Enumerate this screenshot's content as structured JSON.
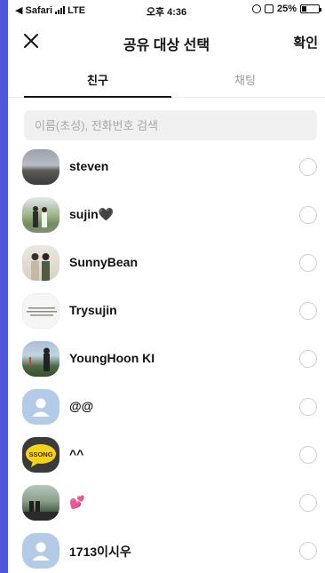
{
  "status_bar": {
    "back_app": "◀ Safari",
    "network": "LTE",
    "time": "오후 4:36",
    "battery": "25%",
    "battery_level": 0.25
  },
  "header": {
    "title": "공유 대상 선택",
    "confirm_label": "확인"
  },
  "tabs": [
    {
      "label": "친구",
      "active": true
    },
    {
      "label": "채팅",
      "active": false
    }
  ],
  "search": {
    "placeholder": "이름(초성), 전화번호 검색",
    "value": ""
  },
  "friends": [
    {
      "name": "steven",
      "avatar": "photo"
    },
    {
      "name": "sujin🖤",
      "avatar": "photo"
    },
    {
      "name": "SunnyBean",
      "avatar": "photo"
    },
    {
      "name": "Trysujin",
      "avatar": "photo"
    },
    {
      "name": "YoungHoon KI",
      "avatar": "photo"
    },
    {
      "name": "@@",
      "avatar": "default-person-icon"
    },
    {
      "name": "^^",
      "avatar": "ssong-logo"
    },
    {
      "name": "💕",
      "avatar": "photo"
    },
    {
      "name": "1713이시우",
      "avatar": "default-person-icon"
    }
  ],
  "ssong_logo_text": "SSONG",
  "colors": {
    "side_bar": "#4f56d8",
    "search_bg": "#f0f0f0",
    "default_avatar": "#b4cbe7",
    "ssong_yellow": "#f5d31a"
  }
}
